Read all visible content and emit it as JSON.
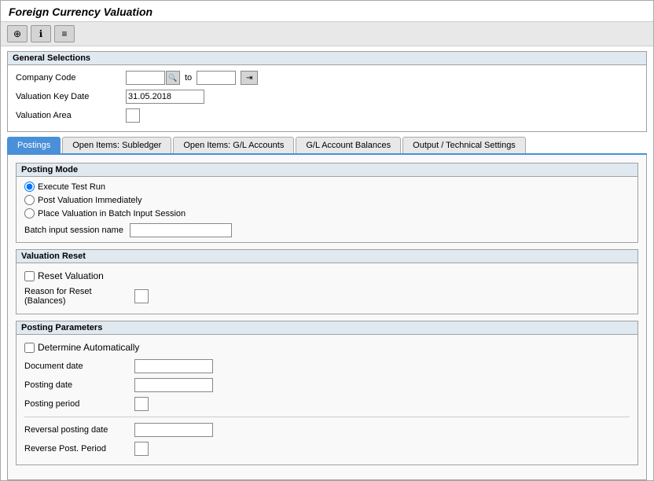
{
  "window": {
    "title": "Foreign Currency Valuation"
  },
  "toolbar": {
    "btn1_icon": "⊕",
    "btn2_icon": "ℹ",
    "btn3_icon": "≡"
  },
  "general_selections": {
    "title": "General Selections",
    "company_code_label": "Company Code",
    "company_code_value": "",
    "company_code_to_value": "",
    "to_label": "to",
    "valuation_key_date_label": "Valuation Key Date",
    "valuation_key_date_value": "31.05.2018",
    "valuation_area_label": "Valuation Area"
  },
  "tabs": [
    {
      "id": "postings",
      "label": "Postings",
      "active": true
    },
    {
      "id": "open-items-subledger",
      "label": "Open Items: Subledger",
      "active": false
    },
    {
      "id": "open-items-gl",
      "label": "Open Items: G/L Accounts",
      "active": false
    },
    {
      "id": "gl-account-balances",
      "label": "G/L Account Balances",
      "active": false
    },
    {
      "id": "output-technical",
      "label": "Output / Technical Settings",
      "active": false
    }
  ],
  "postings": {
    "posting_mode": {
      "title": "Posting Mode",
      "options": [
        {
          "id": "execute-test-run",
          "label": "Execute Test Run",
          "selected": true
        },
        {
          "id": "post-valuation",
          "label": "Post Valuation Immediately",
          "selected": false
        },
        {
          "id": "batch-input",
          "label": "Place Valuation in Batch Input Session",
          "selected": false
        }
      ],
      "batch_session_label": "Batch input session name",
      "batch_session_value": ""
    },
    "valuation_reset": {
      "title": "Valuation Reset",
      "reset_label": "Reset Valuation",
      "reason_label": "Reason for Reset (Balances)"
    },
    "posting_parameters": {
      "title": "Posting Parameters",
      "determine_auto_label": "Determine Automatically",
      "document_date_label": "Document date",
      "document_date_value": "",
      "posting_date_label": "Posting date",
      "posting_date_value": "",
      "posting_period_label": "Posting period",
      "reversal_posting_date_label": "Reversal posting date",
      "reversal_posting_date_value": "",
      "reverse_post_period_label": "Reverse Post. Period"
    }
  }
}
